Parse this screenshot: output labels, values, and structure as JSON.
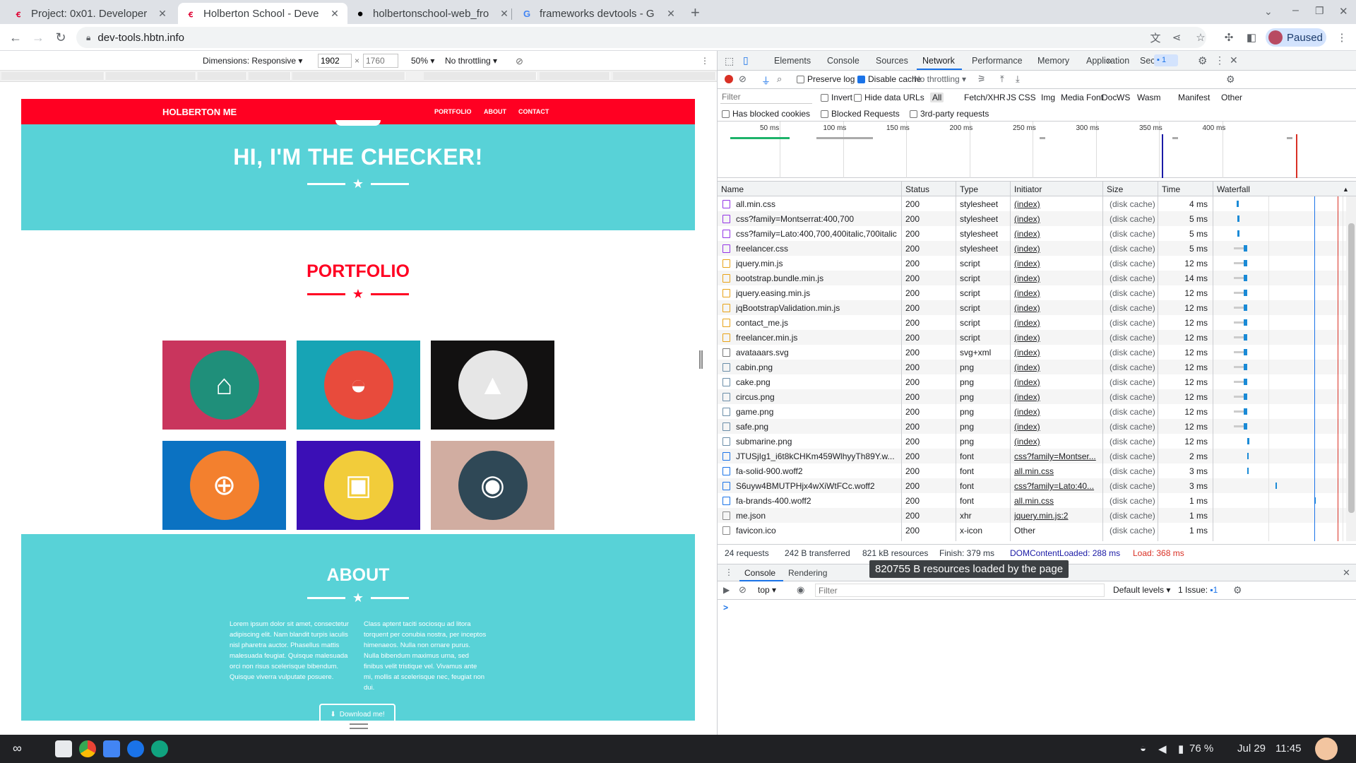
{
  "tabs": [
    {
      "title": "Project: 0x01. Developer",
      "favicon": "holberton-icon"
    },
    {
      "title": "Holberton School - Deve",
      "favicon": "holberton-icon"
    },
    {
      "title": "holbertonschool-web_fro",
      "favicon": "github-icon"
    },
    {
      "title": "frameworks devtools - G",
      "favicon": "google-icon"
    }
  ],
  "toolbar": {
    "url": "dev-tools.hbtn.info",
    "profile_label": "Paused"
  },
  "devmode": {
    "dimensions_label": "Dimensions: Responsive",
    "width": "1902",
    "height_placeholder": "1760",
    "zoom": "50%",
    "throttle": "No throttling"
  },
  "site": {
    "brand": "HOLBERTON ME",
    "nav": [
      "PORTFOLIO",
      "ABOUT",
      "CONTACT"
    ],
    "hero_title": "HI, I'M THE CHECKER!",
    "portfolio_title": "PORTFOLIO",
    "cards": [
      {
        "name": "cabin",
        "bg": "#c9355d",
        "circle": "#1f8f7a",
        "glyph": "⌂"
      },
      {
        "name": "cake",
        "bg": "#17a4b5",
        "circle": "#e84b3c",
        "glyph": "◒"
      },
      {
        "name": "circus",
        "bg": "#121111",
        "circle": "#e6e6e6",
        "glyph": "▲"
      },
      {
        "name": "game",
        "bg": "#0b72c2",
        "circle": "#f3802e",
        "glyph": "⊕"
      },
      {
        "name": "safe",
        "bg": "#3b0fb6",
        "circle": "#f2cc3a",
        "glyph": "▣"
      },
      {
        "name": "submarine",
        "bg": "#d1ada1",
        "circle": "#2f4856",
        "glyph": "◉"
      }
    ],
    "about_title": "ABOUT",
    "about_left": "Lorem ipsum dolor sit amet, consectetur adipiscing elit. Nam blandit turpis iaculis nisl pharetra auctor. Phasellus mattis malesuada feugiat. Quisque malesuada orci non risus scelerisque bibendum. Quisque viverra vulputate posuere.",
    "about_right": "Class aptent taciti sociosqu ad litora torquent per conubia nostra, per inceptos himenaeos. Nulla non ornare purus. Nulla bibendum maximus urna, sed finibus velit tristique vel. Vivamus ante mi, mollis at scelerisque nec, feugiat non dui.",
    "download_label": "Download me!"
  },
  "devtools": {
    "tabs": [
      "Elements",
      "Console",
      "Sources",
      "Network",
      "Performance",
      "Memory",
      "Application",
      "Security"
    ],
    "active_tab": "Network",
    "more": "»",
    "issues_badge": "1",
    "preserve_log": "Preserve log",
    "disable_cache": "Disable cache",
    "throttling": "No throttling",
    "filter_placeholder": "Filter",
    "invert": "Invert",
    "hide_data_urls": "Hide data URLs",
    "types": [
      "All",
      "Fetch/XHR",
      "JS",
      "CSS",
      "Img",
      "Media",
      "Font",
      "Doc",
      "WS",
      "Wasm",
      "Manifest",
      "Other"
    ],
    "has_blocked_cookies": "Has blocked cookies",
    "blocked_requests": "Blocked Requests",
    "third_party": "3rd-party requests",
    "overview_ticks": [
      "50 ms",
      "100 ms",
      "150 ms",
      "200 ms",
      "250 ms",
      "300 ms",
      "350 ms",
      "400 ms"
    ],
    "columns": [
      "Name",
      "Status",
      "Type",
      "Initiator",
      "Size",
      "Time",
      "Waterfall"
    ],
    "requests": [
      {
        "name": "all.min.css",
        "status": "200",
        "type": "stylesheet",
        "initiator": "(index)",
        "size": "(disk cache)",
        "time": "4 ms",
        "icon": "css",
        "wf_start": 30,
        "wf_len": 3
      },
      {
        "name": "css?family=Montserrat:400,700",
        "status": "200",
        "type": "stylesheet",
        "initiator": "(index)",
        "size": "(disk cache)",
        "time": "5 ms",
        "icon": "css",
        "wf_start": 31,
        "wf_len": 3
      },
      {
        "name": "css?family=Lato:400,700,400italic,700italic",
        "status": "200",
        "type": "stylesheet",
        "initiator": "(index)",
        "size": "(disk cache)",
        "time": "5 ms",
        "icon": "css",
        "wf_start": 31,
        "wf_len": 3
      },
      {
        "name": "freelancer.css",
        "status": "200",
        "type": "stylesheet",
        "initiator": "(index)",
        "size": "(disk cache)",
        "time": "5 ms",
        "icon": "css",
        "wf_start": 40,
        "wf_len": 5
      },
      {
        "name": "jquery.min.js",
        "status": "200",
        "type": "script",
        "initiator": "(index)",
        "size": "(disk cache)",
        "time": "12 ms",
        "icon": "js",
        "wf_start": 40,
        "wf_len": 5
      },
      {
        "name": "bootstrap.bundle.min.js",
        "status": "200",
        "type": "script",
        "initiator": "(index)",
        "size": "(disk cache)",
        "time": "14 ms",
        "icon": "js",
        "wf_start": 40,
        "wf_len": 5
      },
      {
        "name": "jquery.easing.min.js",
        "status": "200",
        "type": "script",
        "initiator": "(index)",
        "size": "(disk cache)",
        "time": "12 ms",
        "icon": "js",
        "wf_start": 40,
        "wf_len": 5
      },
      {
        "name": "jqBootstrapValidation.min.js",
        "status": "200",
        "type": "script",
        "initiator": "(index)",
        "size": "(disk cache)",
        "time": "12 ms",
        "icon": "js",
        "wf_start": 40,
        "wf_len": 5
      },
      {
        "name": "contact_me.js",
        "status": "200",
        "type": "script",
        "initiator": "(index)",
        "size": "(disk cache)",
        "time": "12 ms",
        "icon": "js",
        "wf_start": 40,
        "wf_len": 5
      },
      {
        "name": "freelancer.min.js",
        "status": "200",
        "type": "script",
        "initiator": "(index)",
        "size": "(disk cache)",
        "time": "12 ms",
        "icon": "js",
        "wf_start": 40,
        "wf_len": 5
      },
      {
        "name": "avataaars.svg",
        "status": "200",
        "type": "svg+xml",
        "initiator": "(index)",
        "size": "(disk cache)",
        "time": "12 ms",
        "icon": "svg",
        "wf_start": 40,
        "wf_len": 5
      },
      {
        "name": "cabin.png",
        "status": "200",
        "type": "png",
        "initiator": "(index)",
        "size": "(disk cache)",
        "time": "12 ms",
        "icon": "img",
        "wf_start": 40,
        "wf_len": 5
      },
      {
        "name": "cake.png",
        "status": "200",
        "type": "png",
        "initiator": "(index)",
        "size": "(disk cache)",
        "time": "12 ms",
        "icon": "img",
        "wf_start": 40,
        "wf_len": 5
      },
      {
        "name": "circus.png",
        "status": "200",
        "type": "png",
        "initiator": "(index)",
        "size": "(disk cache)",
        "time": "12 ms",
        "icon": "img",
        "wf_start": 40,
        "wf_len": 5
      },
      {
        "name": "game.png",
        "status": "200",
        "type": "png",
        "initiator": "(index)",
        "size": "(disk cache)",
        "time": "12 ms",
        "icon": "img",
        "wf_start": 40,
        "wf_len": 5
      },
      {
        "name": "safe.png",
        "status": "200",
        "type": "png",
        "initiator": "(index)",
        "size": "(disk cache)",
        "time": "12 ms",
        "icon": "img",
        "wf_start": 40,
        "wf_len": 5
      },
      {
        "name": "submarine.png",
        "status": "200",
        "type": "png",
        "initiator": "(index)",
        "size": "(disk cache)",
        "time": "12 ms",
        "icon": "img",
        "wf_start": 45,
        "wf_len": 3
      },
      {
        "name": "JTUSjIg1_i6t8kCHKm459WlhyyTh89Y.w...",
        "status": "200",
        "type": "font",
        "initiator": "css?family=Montser...",
        "size": "(disk cache)",
        "time": "2 ms",
        "icon": "font",
        "wf_start": 45,
        "wf_len": 2
      },
      {
        "name": "fa-solid-900.woff2",
        "status": "200",
        "type": "font",
        "initiator": "all.min.css",
        "size": "(disk cache)",
        "time": "3 ms",
        "icon": "font",
        "wf_start": 45,
        "wf_len": 2
      },
      {
        "name": "S6uyw4BMUTPHjx4wXiWtFCc.woff2",
        "status": "200",
        "type": "font",
        "initiator": "css?family=Lato:40...",
        "size": "(disk cache)",
        "time": "3 ms",
        "icon": "font",
        "wf_start": 85,
        "wf_len": 2
      },
      {
        "name": "fa-brands-400.woff2",
        "status": "200",
        "type": "font",
        "initiator": "all.min.css",
        "size": "(disk cache)",
        "time": "1 ms",
        "icon": "font",
        "wf_start": 140,
        "wf_len": 2
      },
      {
        "name": "me.json",
        "status": "200",
        "type": "xhr",
        "initiator": "jquery.min.js:2",
        "size": "(disk cache)",
        "time": "1 ms",
        "icon": "doc",
        "wf_start": 0,
        "wf_len": 0
      },
      {
        "name": "favicon.ico",
        "status": "200",
        "type": "x-icon",
        "initiator": "Other",
        "size": "(disk cache)",
        "time": "1 ms",
        "icon": "doc",
        "wf_start": 0,
        "wf_len": 0
      }
    ],
    "status": {
      "requests": "24 requests",
      "transferred": "242 B transferred",
      "resources": "821 kB resources",
      "finish": "Finish: 379 ms",
      "dcl": "DOMContentLoaded: 288 ms",
      "load": "Load: 368 ms"
    },
    "tooltip": "820755 B resources loaded by the page",
    "drawer_tabs": [
      "Console",
      "Rendering"
    ],
    "context": "top",
    "console_filter": "Filter",
    "levels": "Default levels",
    "issue_label": "1 Issue:",
    "issue_count": "1",
    "prompt": ">"
  },
  "taskbar": {
    "battery": "76 %",
    "date": "Jul 29",
    "time": "11:45"
  },
  "colors": {
    "accent": "#1a73e8",
    "site_red": "#ff0022",
    "site_teal": "#58d2d7",
    "load_red": "#d93025",
    "dcl_blue": "#1a1aa6"
  }
}
